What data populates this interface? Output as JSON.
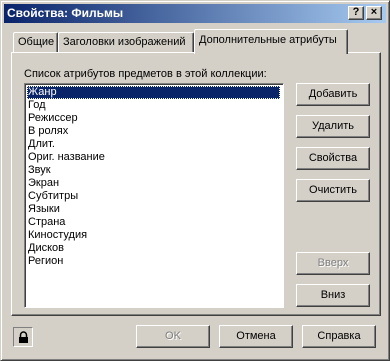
{
  "window": {
    "title": "Свойства: Фильмы",
    "help_glyph": "?",
    "close_glyph": "×"
  },
  "tabs": [
    {
      "label": "Общие",
      "selected": false
    },
    {
      "label": "Заголовки изображений",
      "selected": false
    },
    {
      "label": "Дополнительные атрибуты",
      "selected": true
    }
  ],
  "attributes": {
    "label": "Список атрибутов предметов в этой коллекции:",
    "items": [
      "Жанр",
      "Год",
      "Режиссер",
      "В ролях",
      "Длит.",
      "Ориг. название",
      "Звук",
      "Экран",
      "Субтитры",
      "Языки",
      "Страна",
      "Киностудия",
      "Дисков",
      "Регион"
    ],
    "selected_index": 0
  },
  "side_buttons": {
    "add": "Добавить",
    "delete": "Удалить",
    "properties": "Свойства",
    "clear": "Очистить",
    "up": "Вверх",
    "down": "Вниз"
  },
  "footer": {
    "ok": "OK",
    "cancel": "Отмена",
    "help": "Справка",
    "lock_icon": "lock-icon"
  }
}
